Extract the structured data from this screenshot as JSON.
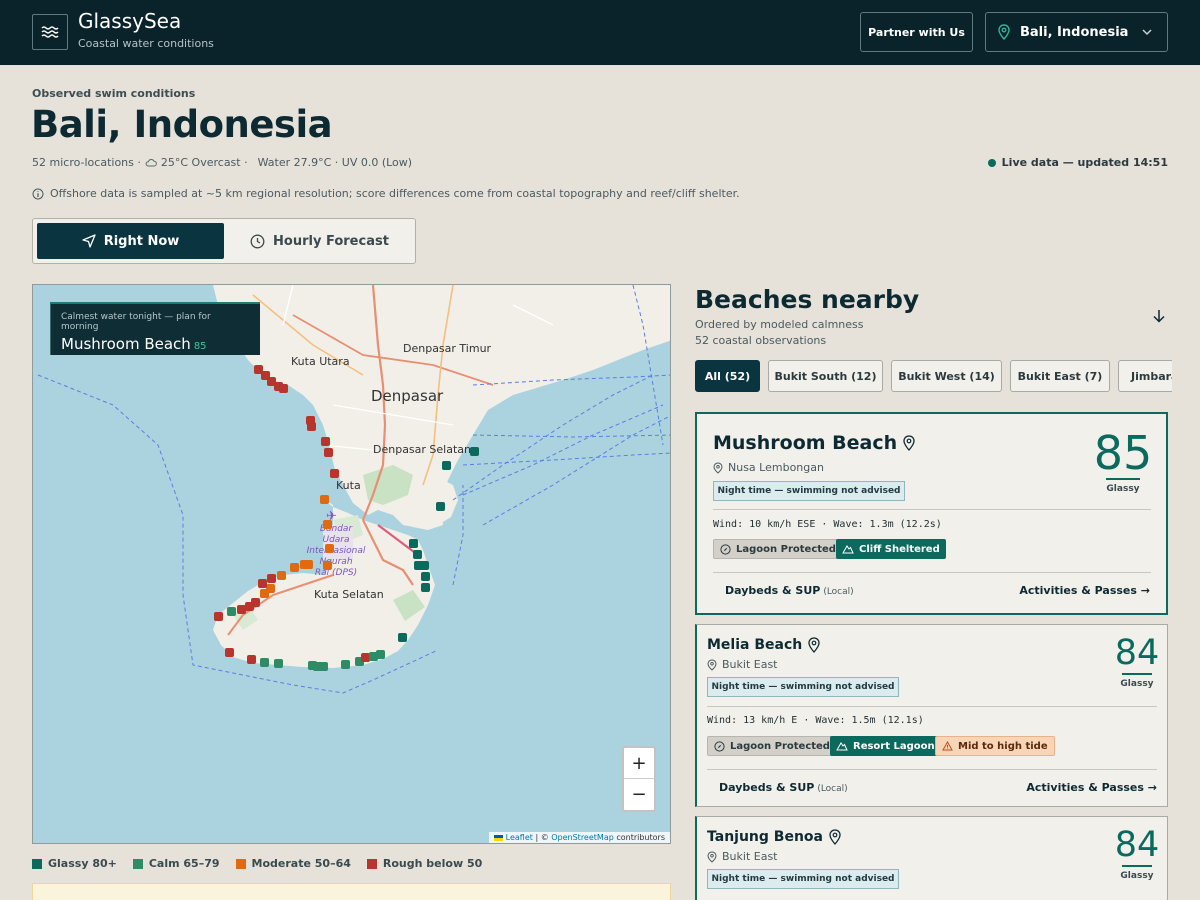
{
  "header": {
    "brand_name": "GlassySea",
    "brand_tagline": "Coastal water conditions",
    "partner_label": "Partner with Us",
    "location_label": "Bali, Indonesia"
  },
  "page": {
    "eyebrow": "Observed swim conditions",
    "title": "Bali, Indonesia",
    "meta_locations": "52 micro-locations ·",
    "meta_weather": "25°C Overcast ·",
    "meta_water": "Water 27.9°C · UV 0.0 (Low)",
    "live_status": "Live data — updated 14:51",
    "info_note": "Offshore data is sampled at ~5 km regional resolution; score differences come from coastal topography and reef/cliff shelter."
  },
  "tabs": {
    "right_now": "Right Now",
    "hourly": "Hourly Forecast"
  },
  "map": {
    "callout_sub": "Calmest water tonight — plan for morning",
    "callout_name": "Mushroom Beach",
    "callout_score": "85",
    "labels": {
      "kuta_utara": "Kuta Utara",
      "denpasar_timur": "Denpasar Timur",
      "denpasar": "Denpasar",
      "denpasar_selatan": "Denpasar Selatan",
      "kuta": "Kuta",
      "airport_1": "Bandar",
      "airport_2": "Udara",
      "airport_3": "Internasional",
      "airport_4": "Ngurah",
      "airport_5": "Rai (DPS)",
      "kuta_selatan": "Kuta Selatan"
    },
    "zoom_in": "+",
    "zoom_out": "−",
    "attribution_leaflet": "Leaflet",
    "attribution_sep": " | © ",
    "attribution_osm": "OpenStreetMap",
    "attribution_tail": " contributors"
  },
  "legend": [
    {
      "label": "Glassy 80+",
      "color": "#0b6a5d"
    },
    {
      "label": "Calm 65–79",
      "color": "#2e8b66"
    },
    {
      "label": "Moderate 50–64",
      "color": "#e06a12"
    },
    {
      "label": "Rough below 50",
      "color": "#b8352d"
    }
  ],
  "beaches": {
    "title": "Beaches nearby",
    "subtitle": "Ordered by modeled calmness",
    "count": "52 coastal observations",
    "filters": [
      "All (52)",
      "Bukit South (12)",
      "Bukit West (14)",
      "Bukit East (7)",
      "Jimbaran"
    ],
    "cards": [
      {
        "name": "Mushroom Beach",
        "area": "Nusa Lembongan",
        "night": "Night time — swimming not advised",
        "score": "85",
        "score_label": "Glassy",
        "wind": "Wind: 10 km/h ESE · Wave: 1.3m (12.2s)",
        "tags": [
          "Lagoon Protected",
          "Cliff Sheltered"
        ],
        "footer_left": "Daybeds & SUP",
        "footer_local": "(Local)",
        "footer_right": "Activities & Passes →"
      },
      {
        "name": "Melia Beach",
        "area": "Bukit East",
        "night": "Night time — swimming not advised",
        "score": "84",
        "score_label": "Glassy",
        "wind": "Wind: 13 km/h E · Wave: 1.5m (12.1s)",
        "tags": [
          "Lagoon Protected",
          "Resort Lagoon",
          "Mid to high tide"
        ],
        "footer_left": "Daybeds & SUP",
        "footer_local": "(Local)",
        "footer_right": "Activities & Passes →"
      },
      {
        "name": "Tanjung Benoa",
        "area": "Bukit East",
        "night": "Night time — swimming not advised",
        "score": "84",
        "score_label": "Glassy"
      }
    ]
  }
}
